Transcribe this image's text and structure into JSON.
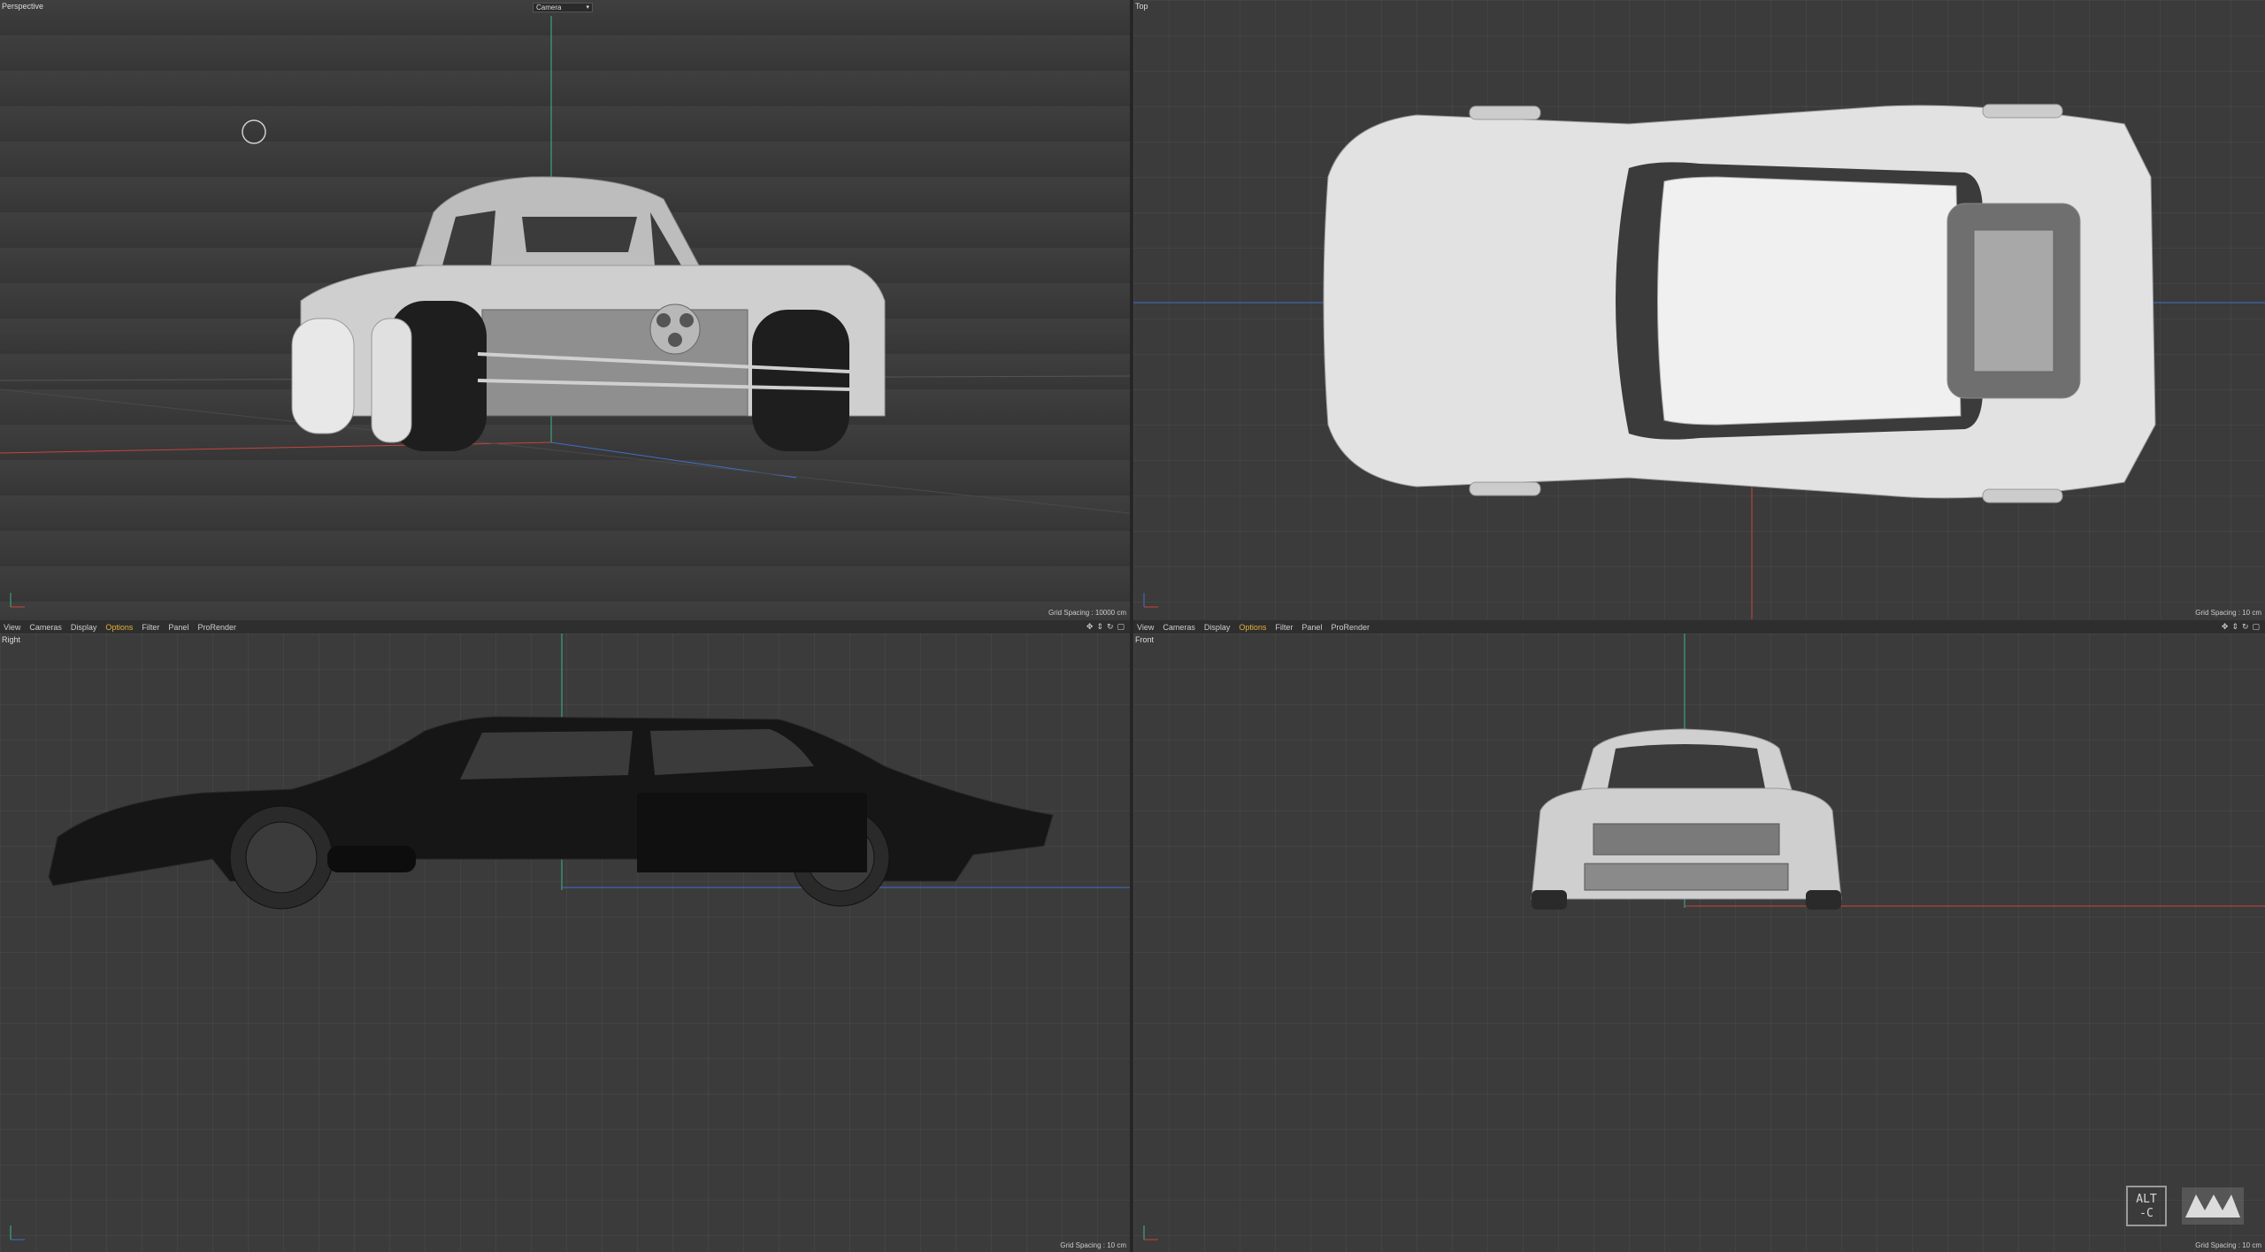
{
  "viewports": {
    "perspective": {
      "label": "Perspective",
      "camera": "Camera",
      "grid_spacing": "Grid Spacing : 10000 cm"
    },
    "top": {
      "label": "Top",
      "grid_spacing": "Grid Spacing : 10 cm"
    },
    "right": {
      "label": "Right",
      "grid_spacing": "Grid Spacing : 10 cm"
    },
    "front": {
      "label": "Front",
      "grid_spacing": "Grid Spacing : 10 cm"
    }
  },
  "menus": {
    "left": [
      "View",
      "Cameras",
      "Display",
      "Options",
      "Filter",
      "Panel",
      "ProRender"
    ],
    "right": [
      "View",
      "Cameras",
      "Display",
      "Options",
      "Filter",
      "Panel",
      "ProRender"
    ],
    "active": "Options"
  },
  "nav_icons": [
    "move-icon",
    "zoom-icon",
    "rotate-icon",
    "maximize-icon"
  ],
  "logo": {
    "text_line1": "ALT",
    "text_line2": "-C"
  },
  "colors": {
    "accent": "#e3b23c",
    "axis_x": "#c8433f",
    "axis_y": "#3fb58a",
    "axis_z": "#3f6fc8",
    "model": "#d9d9d9"
  }
}
